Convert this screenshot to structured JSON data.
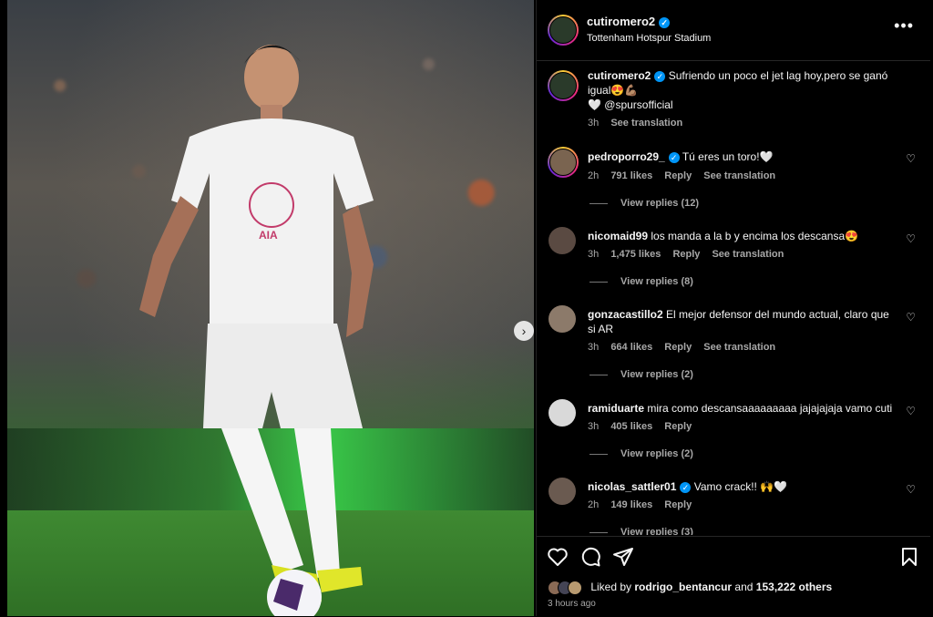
{
  "post": {
    "username": "cutiromero2",
    "location": "Tottenham Hotspur Stadium",
    "caption_user": "cutiromero2",
    "caption_text": "Sufriendo un poco el jet lag hoy,pero se ganó igual😍💪🏽",
    "caption_line2": "🤍 @spursofficial",
    "caption_time": "3h",
    "caption_translate": "See translation",
    "more_label": "•••"
  },
  "comments": [
    {
      "user": "pedroporro29_",
      "text": "Tú eres un toro!🤍",
      "time": "2h",
      "likes": "791 likes",
      "reply": "Reply",
      "translate": "See translation",
      "replies": "View replies (12)"
    },
    {
      "user": "nicomaid99",
      "text": "los manda a la b y encima los descansa😍",
      "time": "3h",
      "likes": "1,475 likes",
      "reply": "Reply",
      "translate": "See translation",
      "replies": "View replies (8)"
    },
    {
      "user": "gonzacastillo2",
      "text": "El mejor defensor del mundo actual, claro que si AR",
      "time": "3h",
      "likes": "664 likes",
      "reply": "Reply",
      "translate": "See translation",
      "replies": "View replies (2)"
    },
    {
      "user": "ramiduarte",
      "text": "mira como descansaaaaaaaaa jajajajaja vamo cuti",
      "time": "3h",
      "likes": "405 likes",
      "reply": "Reply",
      "translate": "",
      "replies": "View replies (2)"
    },
    {
      "user": "nicolas_sattler01",
      "text": "Vamo crack!! 🙌🤍",
      "time": "2h",
      "likes": "149 likes",
      "reply": "Reply",
      "translate": "",
      "replies": "View replies (3)"
    }
  ],
  "footer": {
    "liked_prefix": "Liked by",
    "liked_user": "rodrigo_bentancur",
    "liked_suffix": "and",
    "liked_count": "153,222 others",
    "posted": "3 hours ago"
  },
  "icons": {
    "next": "chevron-right-icon",
    "like": "heart-icon",
    "comment": "comment-icon",
    "share": "send-icon",
    "save": "bookmark-icon"
  },
  "colors": {
    "verified": "#0095f6",
    "background": "#000000"
  }
}
